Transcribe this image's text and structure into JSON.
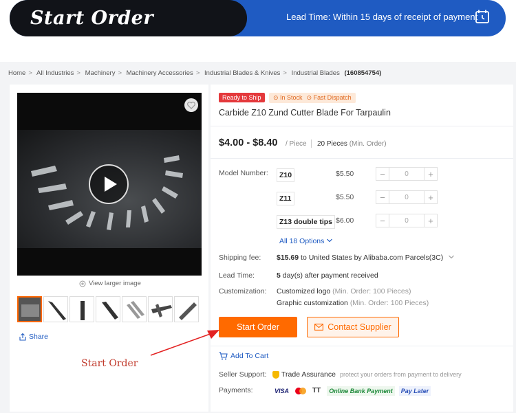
{
  "banner": {
    "title": "Start Order",
    "lead_time": "Lead Time: Within 15 days of receipt of payment",
    "icon": "calendar-clock-icon"
  },
  "breadcrumb": {
    "items": [
      "Home",
      "All Industries",
      "Machinery",
      "Machinery Accessories",
      "Industrial Blades & Knives",
      "Industrial Blades"
    ],
    "product_id": "(160854754)"
  },
  "gallery": {
    "view_larger": "View larger image",
    "share": "Share"
  },
  "product": {
    "tag_ready": "Ready to Ship",
    "tag_in_stock": "In Stock",
    "tag_fast_dispatch": "Fast Dispatch",
    "title": "Carbide Z10 Zund Cutter Blade For Tarpaulin",
    "price_range": "$4.00 - $8.40",
    "price_unit": "/ Piece",
    "min_order": "20 Pieces",
    "min_order_label": "(Min. Order)"
  },
  "model": {
    "label": "Model Number:",
    "items": [
      {
        "name": "Z10",
        "price": "$5.50",
        "qty": "0"
      },
      {
        "name": "Z11",
        "price": "$5.50",
        "qty": "0"
      },
      {
        "name": "Z13 double tips",
        "price": "$6.00",
        "qty": "0"
      }
    ],
    "minus": "−",
    "plus": "+",
    "all_options": "All 18 Options"
  },
  "shipping": {
    "label": "Shipping fee:",
    "amount": "$15.69",
    "detail": "to United States by Alibaba.com Parcels(3C)"
  },
  "lead": {
    "label": "Lead Time:",
    "days": "5",
    "detail": "day(s) after payment received"
  },
  "customization": {
    "label": "Customization:",
    "line1": "Customized logo",
    "line1_note": "(Min. Order: 100 Pieces)",
    "line2": "Graphic customization",
    "line2_note": "(Min. Order: 100 Pieces)"
  },
  "actions": {
    "start_order": "Start Order",
    "contact_supplier": "Contact Supplier",
    "add_to_cart": "Add To Cart"
  },
  "annotation": "Start Order",
  "support": {
    "label": "Seller Support:",
    "trade_assurance": "Trade Assurance",
    "note": "protect your orders from payment to delivery"
  },
  "payments": {
    "label": "Payments:",
    "methods": [
      "VISA",
      "TT",
      "Online Bank Payment",
      "Pay Later"
    ]
  },
  "colors": {
    "accent_orange": "#ff6a00",
    "banner_blue": "#1f5bc2",
    "link_blue": "#1f5bc2"
  }
}
